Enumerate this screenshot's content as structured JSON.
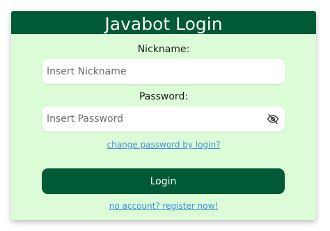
{
  "login": {
    "title": "Javabot Login",
    "nickname_label": "Nickname:",
    "nickname_placeholder": "Insert Nickname",
    "password_label": "Password:",
    "password_placeholder": "Insert Password",
    "change_password_link": "change password by login?",
    "login_button": "Login",
    "register_link": "no account? register now!"
  },
  "icons": {
    "password_toggle": "eye-slash-icon"
  },
  "colors": {
    "brand_green": "#005a35",
    "card_background": "#dcfcd8",
    "link_blue": "#3d8fd8"
  }
}
